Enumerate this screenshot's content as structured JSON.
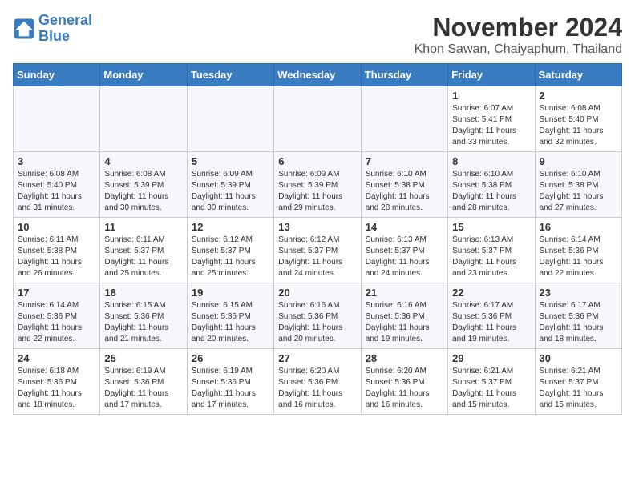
{
  "header": {
    "logo_line1": "General",
    "logo_line2": "Blue",
    "title": "November 2024",
    "subtitle": "Khon Sawan, Chaiyaphum, Thailand"
  },
  "weekdays": [
    "Sunday",
    "Monday",
    "Tuesday",
    "Wednesday",
    "Thursday",
    "Friday",
    "Saturday"
  ],
  "weeks": [
    [
      {
        "day": "",
        "info": ""
      },
      {
        "day": "",
        "info": ""
      },
      {
        "day": "",
        "info": ""
      },
      {
        "day": "",
        "info": ""
      },
      {
        "day": "",
        "info": ""
      },
      {
        "day": "1",
        "info": "Sunrise: 6:07 AM\nSunset: 5:41 PM\nDaylight: 11 hours and 33 minutes."
      },
      {
        "day": "2",
        "info": "Sunrise: 6:08 AM\nSunset: 5:40 PM\nDaylight: 11 hours and 32 minutes."
      }
    ],
    [
      {
        "day": "3",
        "info": "Sunrise: 6:08 AM\nSunset: 5:40 PM\nDaylight: 11 hours and 31 minutes."
      },
      {
        "day": "4",
        "info": "Sunrise: 6:08 AM\nSunset: 5:39 PM\nDaylight: 11 hours and 30 minutes."
      },
      {
        "day": "5",
        "info": "Sunrise: 6:09 AM\nSunset: 5:39 PM\nDaylight: 11 hours and 30 minutes."
      },
      {
        "day": "6",
        "info": "Sunrise: 6:09 AM\nSunset: 5:39 PM\nDaylight: 11 hours and 29 minutes."
      },
      {
        "day": "7",
        "info": "Sunrise: 6:10 AM\nSunset: 5:38 PM\nDaylight: 11 hours and 28 minutes."
      },
      {
        "day": "8",
        "info": "Sunrise: 6:10 AM\nSunset: 5:38 PM\nDaylight: 11 hours and 28 minutes."
      },
      {
        "day": "9",
        "info": "Sunrise: 6:10 AM\nSunset: 5:38 PM\nDaylight: 11 hours and 27 minutes."
      }
    ],
    [
      {
        "day": "10",
        "info": "Sunrise: 6:11 AM\nSunset: 5:38 PM\nDaylight: 11 hours and 26 minutes."
      },
      {
        "day": "11",
        "info": "Sunrise: 6:11 AM\nSunset: 5:37 PM\nDaylight: 11 hours and 25 minutes."
      },
      {
        "day": "12",
        "info": "Sunrise: 6:12 AM\nSunset: 5:37 PM\nDaylight: 11 hours and 25 minutes."
      },
      {
        "day": "13",
        "info": "Sunrise: 6:12 AM\nSunset: 5:37 PM\nDaylight: 11 hours and 24 minutes."
      },
      {
        "day": "14",
        "info": "Sunrise: 6:13 AM\nSunset: 5:37 PM\nDaylight: 11 hours and 24 minutes."
      },
      {
        "day": "15",
        "info": "Sunrise: 6:13 AM\nSunset: 5:37 PM\nDaylight: 11 hours and 23 minutes."
      },
      {
        "day": "16",
        "info": "Sunrise: 6:14 AM\nSunset: 5:36 PM\nDaylight: 11 hours and 22 minutes."
      }
    ],
    [
      {
        "day": "17",
        "info": "Sunrise: 6:14 AM\nSunset: 5:36 PM\nDaylight: 11 hours and 22 minutes."
      },
      {
        "day": "18",
        "info": "Sunrise: 6:15 AM\nSunset: 5:36 PM\nDaylight: 11 hours and 21 minutes."
      },
      {
        "day": "19",
        "info": "Sunrise: 6:15 AM\nSunset: 5:36 PM\nDaylight: 11 hours and 20 minutes."
      },
      {
        "day": "20",
        "info": "Sunrise: 6:16 AM\nSunset: 5:36 PM\nDaylight: 11 hours and 20 minutes."
      },
      {
        "day": "21",
        "info": "Sunrise: 6:16 AM\nSunset: 5:36 PM\nDaylight: 11 hours and 19 minutes."
      },
      {
        "day": "22",
        "info": "Sunrise: 6:17 AM\nSunset: 5:36 PM\nDaylight: 11 hours and 19 minutes."
      },
      {
        "day": "23",
        "info": "Sunrise: 6:17 AM\nSunset: 5:36 PM\nDaylight: 11 hours and 18 minutes."
      }
    ],
    [
      {
        "day": "24",
        "info": "Sunrise: 6:18 AM\nSunset: 5:36 PM\nDaylight: 11 hours and 18 minutes."
      },
      {
        "day": "25",
        "info": "Sunrise: 6:19 AM\nSunset: 5:36 PM\nDaylight: 11 hours and 17 minutes."
      },
      {
        "day": "26",
        "info": "Sunrise: 6:19 AM\nSunset: 5:36 PM\nDaylight: 11 hours and 17 minutes."
      },
      {
        "day": "27",
        "info": "Sunrise: 6:20 AM\nSunset: 5:36 PM\nDaylight: 11 hours and 16 minutes."
      },
      {
        "day": "28",
        "info": "Sunrise: 6:20 AM\nSunset: 5:36 PM\nDaylight: 11 hours and 16 minutes."
      },
      {
        "day": "29",
        "info": "Sunrise: 6:21 AM\nSunset: 5:37 PM\nDaylight: 11 hours and 15 minutes."
      },
      {
        "day": "30",
        "info": "Sunrise: 6:21 AM\nSunset: 5:37 PM\nDaylight: 11 hours and 15 minutes."
      }
    ]
  ]
}
